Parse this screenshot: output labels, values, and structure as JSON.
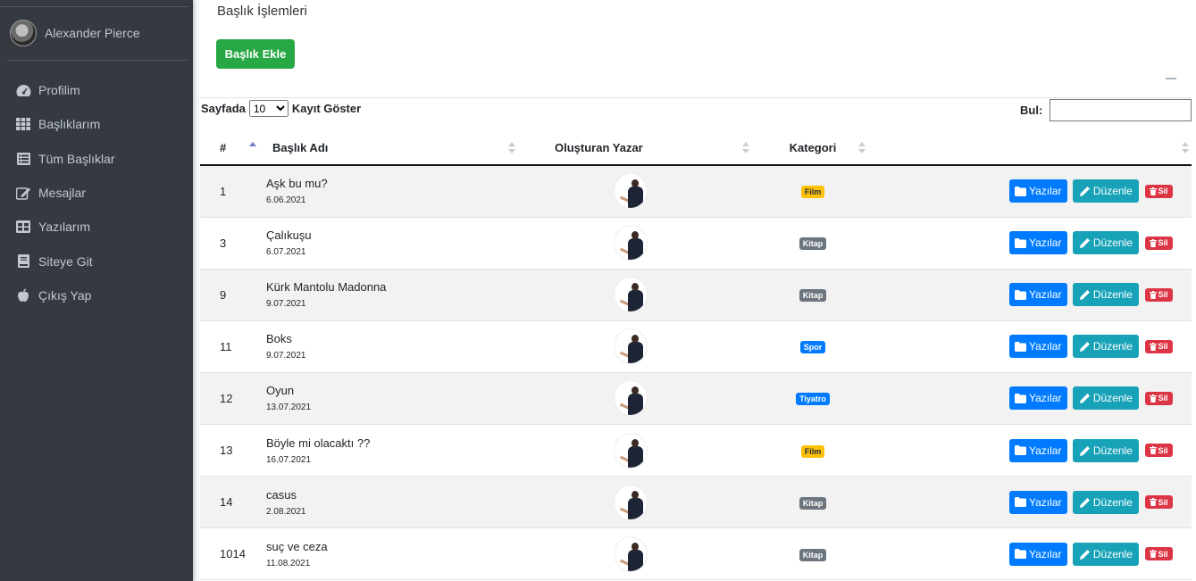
{
  "user": {
    "name": "Alexander Pierce"
  },
  "nav": [
    {
      "label": "Profilim",
      "icon": "dashboard-icon"
    },
    {
      "label": "Başlıklarım",
      "icon": "grid-icon"
    },
    {
      "label": "Tüm Başlıklar",
      "icon": "list-icon"
    },
    {
      "label": "Mesajlar",
      "icon": "edit-icon"
    },
    {
      "label": "Yazılarım",
      "icon": "table-icon"
    },
    {
      "label": "Siteye Git",
      "icon": "book-icon"
    },
    {
      "label": "Çıkış Yap",
      "icon": "apple-icon"
    }
  ],
  "page": {
    "title": "Başlık İşlemleri",
    "add_button": "Başlık Ekle"
  },
  "controls": {
    "length_prefix": "Sayfada",
    "length_value": "10",
    "length_suffix": "Kayıt Göster",
    "search_label": "Bul:"
  },
  "columns": [
    "#",
    "Başlık Adı",
    "Oluşturan Yazar",
    "Kategori"
  ],
  "rows": [
    {
      "id": "1",
      "title": "Aşk bu mu?",
      "date": "6.06.2021",
      "category": "Film"
    },
    {
      "id": "3",
      "title": "Çalıkuşu",
      "date": "6.07.2021",
      "category": "Kitap"
    },
    {
      "id": "9",
      "title": "Kürk Mantolu Madonna",
      "date": "9.07.2021",
      "category": "Kitap"
    },
    {
      "id": "11",
      "title": "Boks",
      "date": "9.07.2021",
      "category": "Spor"
    },
    {
      "id": "12",
      "title": "Oyun",
      "date": "13.07.2021",
      "category": "Tiyatro"
    },
    {
      "id": "13",
      "title": "Böyle mi olacaktı ??",
      "date": "16.07.2021",
      "category": "Film"
    },
    {
      "id": "14",
      "title": "casus",
      "date": "2.08.2021",
      "category": "Kitap"
    },
    {
      "id": "1014",
      "title": "suç ve ceza",
      "date": "11.08.2021",
      "category": "Kitap"
    }
  ],
  "category_colors": {
    "Film": "#ffc107",
    "Kitap": "#6c757d",
    "Spor": "#007bff",
    "Tiyatro": "#007bff"
  },
  "actions": {
    "posts": "Yazılar",
    "edit": "Düzenle",
    "delete": "Sil"
  }
}
